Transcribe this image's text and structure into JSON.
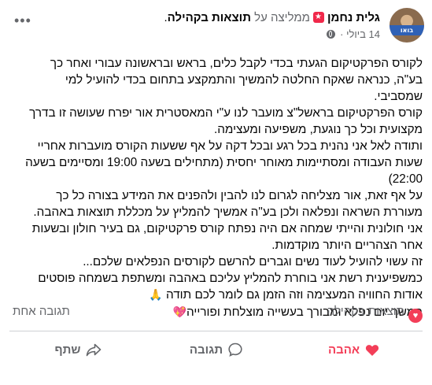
{
  "header": {
    "author": "גלית נחמן",
    "recommends": "ממליצה על",
    "target": "תוצאות בקהילה",
    "date": "14 ביולי",
    "separator": "·",
    "avatar_badge": "בואו",
    "more": "•••"
  },
  "body": {
    "lines": [
      "לקורס הפרקטיקום הגעתי בכדי לקבל כלים, בראש ובראשונה עבורי ואחר כך",
      "בע\"ה, כנראה שאקח החלטה  להמשיך והתמקצע בתחום בכדי להועיל למי",
      "שמסביבי.",
      "קורס הפרקטיקום בראשל\"צ מועבר לנו ע\"י המאסטרית אור יפרח שעושה זו בדרך",
      "מקצועית וכל כך נוגעת, משפיעה ומעצימה.",
      "ותודה לאל אני נהנית בכל רגע ובכל דקה על אף ששעות הקורס מועברות אחריי",
      "שעות העבודה ומסתיימות מאוחר יחסית (מתחילים בשעה 19:00 ומסיימים בשעה",
      "22:00)",
      "על אף זאת, אור מצליחה לגרום לנו להבין ולהפנים את המידע בצורה כל כך",
      "מעוררת השראה ונפלאה  ולכן בע\"ה אמשיך להמליץ על מכללת תוצאות באהבה.",
      "אני חולונית והייתי שמחה אם היה נפתח קורס פרקטיקום, גם בעיר חולון ובשעות",
      "אחר הצהריים היותר מוקדמות.",
      " זה עשוי להועיל לעוד נשים וגברים להרשם לקורסים הנפלאים שלכם...",
      "כמשפיענית רשת אני בוחרת להמליץ עליכם באהבה ומשתפת בשמחה פוסטים",
      "אודות החוויה המעצימה וזה הזמן גם לומר לכם תודה",
      "המשך יום נפלא ומבורך בעשייה מוצלחת ופורייה"
    ],
    "emoji_thanks": "🙏",
    "emoji_heart": "💖"
  },
  "reactions": {
    "label": "תוצאות בקהילה",
    "comments": "תגובה אחת"
  },
  "actions": {
    "love": "אהבה",
    "comment": "תגובה",
    "share": "שתף"
  },
  "colors": {
    "love": "#f33e58",
    "secondary": "#65676b",
    "recommend_badge": "#f0284a"
  }
}
